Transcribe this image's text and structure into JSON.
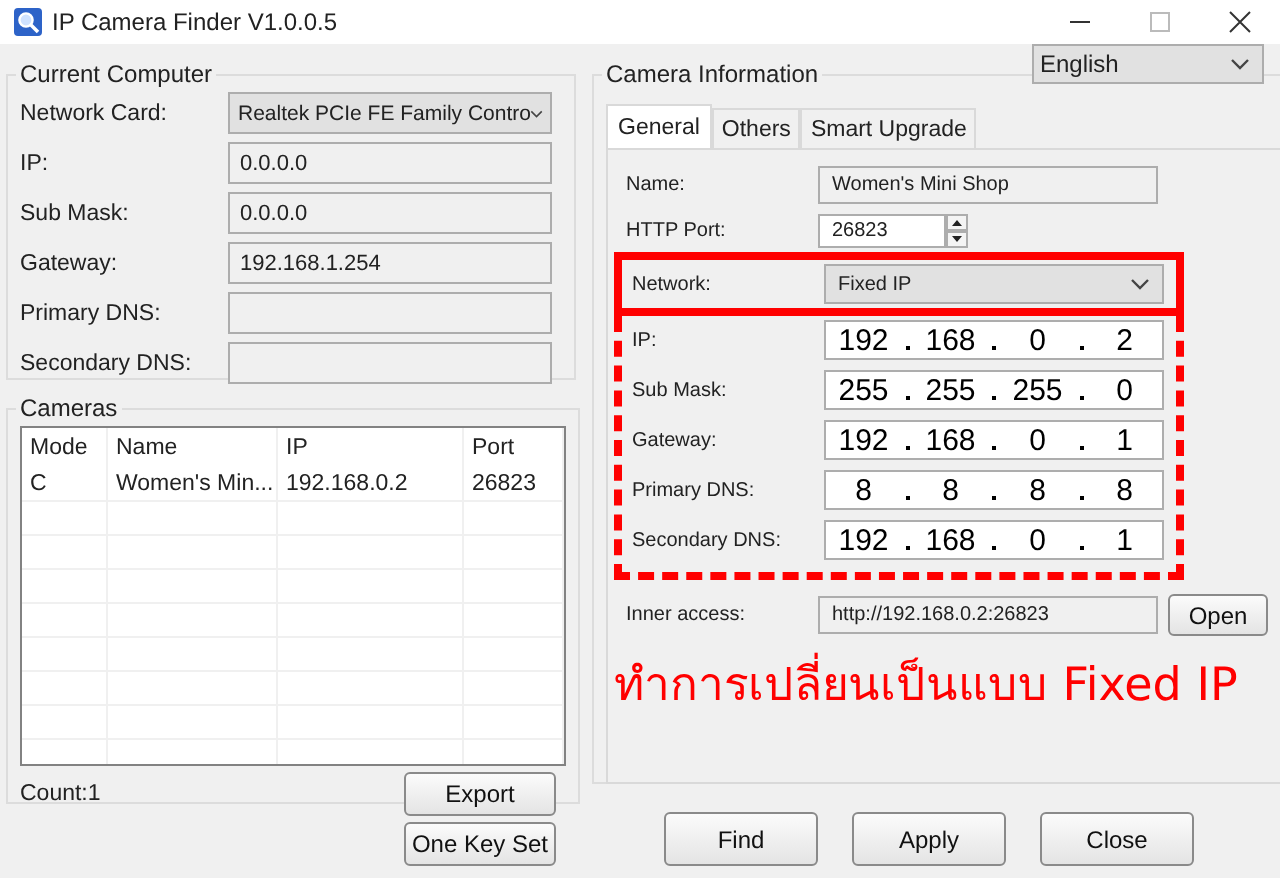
{
  "window": {
    "title": "IP Camera Finder V1.0.0.5"
  },
  "current_computer": {
    "title": "Current Computer",
    "fields": [
      {
        "label": "Network Card:",
        "kind": "select",
        "value": "Realtek PCIe FE Family Contro"
      },
      {
        "label": "IP:",
        "kind": "text",
        "value": "0.0.0.0"
      },
      {
        "label": "Sub Mask:",
        "kind": "text",
        "value": "0.0.0.0"
      },
      {
        "label": "Gateway:",
        "kind": "text",
        "value": "192.168.1.254"
      },
      {
        "label": "Primary DNS:",
        "kind": "text"
      },
      {
        "label": "Secondary DNS:",
        "kind": "text"
      }
    ]
  },
  "cameras": {
    "title": "Cameras",
    "columns": [
      "Mode",
      "Name",
      "IP",
      "Port"
    ],
    "rows": [
      [
        "C",
        "Women's Min...",
        "192.168.0.2",
        "26823"
      ]
    ],
    "count": "Count:1",
    "export_button": "Export"
  },
  "one_key_set_button": "One Key Set",
  "camera_information": {
    "title": "Camera Information",
    "language": "English",
    "tabs": [
      {
        "label": "General",
        "selected": true
      },
      {
        "label": "Others",
        "selected": false
      },
      {
        "label": "Smart Upgrade",
        "selected": false
      }
    ],
    "fields": [
      {
        "label": "Name:",
        "kind": "text",
        "value": "Women's Mini Shop"
      },
      {
        "label": "HTTP Port:",
        "kind": "spin",
        "value": "26823"
      },
      {
        "label": "Network:",
        "kind": "select",
        "value": "Fixed IP"
      },
      {
        "label": "IP:",
        "kind": "ip",
        "octets": [
          "192",
          "168",
          "0",
          "2"
        ]
      },
      {
        "label": "Sub Mask:",
        "kind": "ip",
        "octets": [
          "255",
          "255",
          "255",
          "0"
        ]
      },
      {
        "label": "Gateway:",
        "kind": "ip",
        "octets": [
          "192",
          "168",
          "0",
          "1"
        ]
      },
      {
        "label": "Primary DNS:",
        "kind": "ip",
        "octets": [
          "8",
          "8",
          "8",
          "8"
        ]
      },
      {
        "label": "Secondary DNS:",
        "kind": "ip",
        "octets": [
          "192",
          "168",
          "0",
          "1"
        ]
      },
      {
        "label": "Inner access:",
        "kind": "text",
        "value": "http://192.168.0.2:26823",
        "button": "Open"
      }
    ],
    "annotation": "ทำการเปลี่ยนเป็นแบบ Fixed IP"
  },
  "buttons": [
    "Find",
    "Apply",
    "Close"
  ]
}
